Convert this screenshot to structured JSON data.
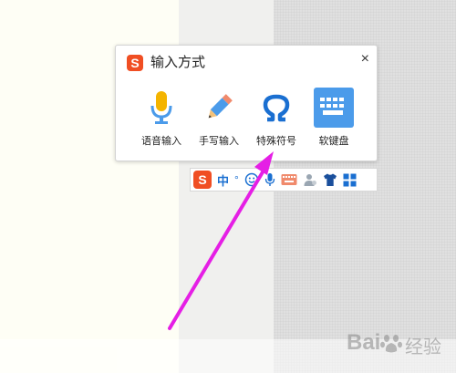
{
  "panel": {
    "logo": "S",
    "title": "输入方式",
    "close": "×",
    "options": [
      {
        "label": "语音输入",
        "icon": "microphone-icon"
      },
      {
        "label": "手写输入",
        "icon": "pencil-icon"
      },
      {
        "label": "特殊符号",
        "icon": "omega-icon"
      },
      {
        "label": "软键盘",
        "icon": "keyboard-icon"
      }
    ]
  },
  "toolbar": {
    "logo": "S",
    "lang": "中",
    "punct": "°",
    "items": [
      "smiley-icon",
      "microphone-icon",
      "keyboard-icon",
      "user-icon",
      "shirt-icon",
      "grid-icon"
    ]
  },
  "watermark": {
    "text": "Bai",
    "suffix": "经验"
  },
  "colors": {
    "accent": "#4b9bea",
    "brand": "#f04e23",
    "arrow": "#e51fe5"
  }
}
